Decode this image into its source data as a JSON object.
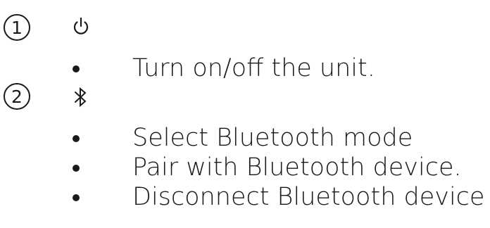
{
  "items": [
    {
      "number": "1",
      "icon": "power-icon",
      "bullets": [
        "Turn on/off the unit."
      ]
    },
    {
      "number": "2",
      "icon": "bluetooth-icon",
      "bullets": [
        "Select Bluetooth mode",
        "Pair with Bluetooth device.",
        "Disconnect Bluetooth device"
      ]
    }
  ],
  "colors": {
    "text": "#1a1a1a",
    "background": "#ffffff"
  }
}
